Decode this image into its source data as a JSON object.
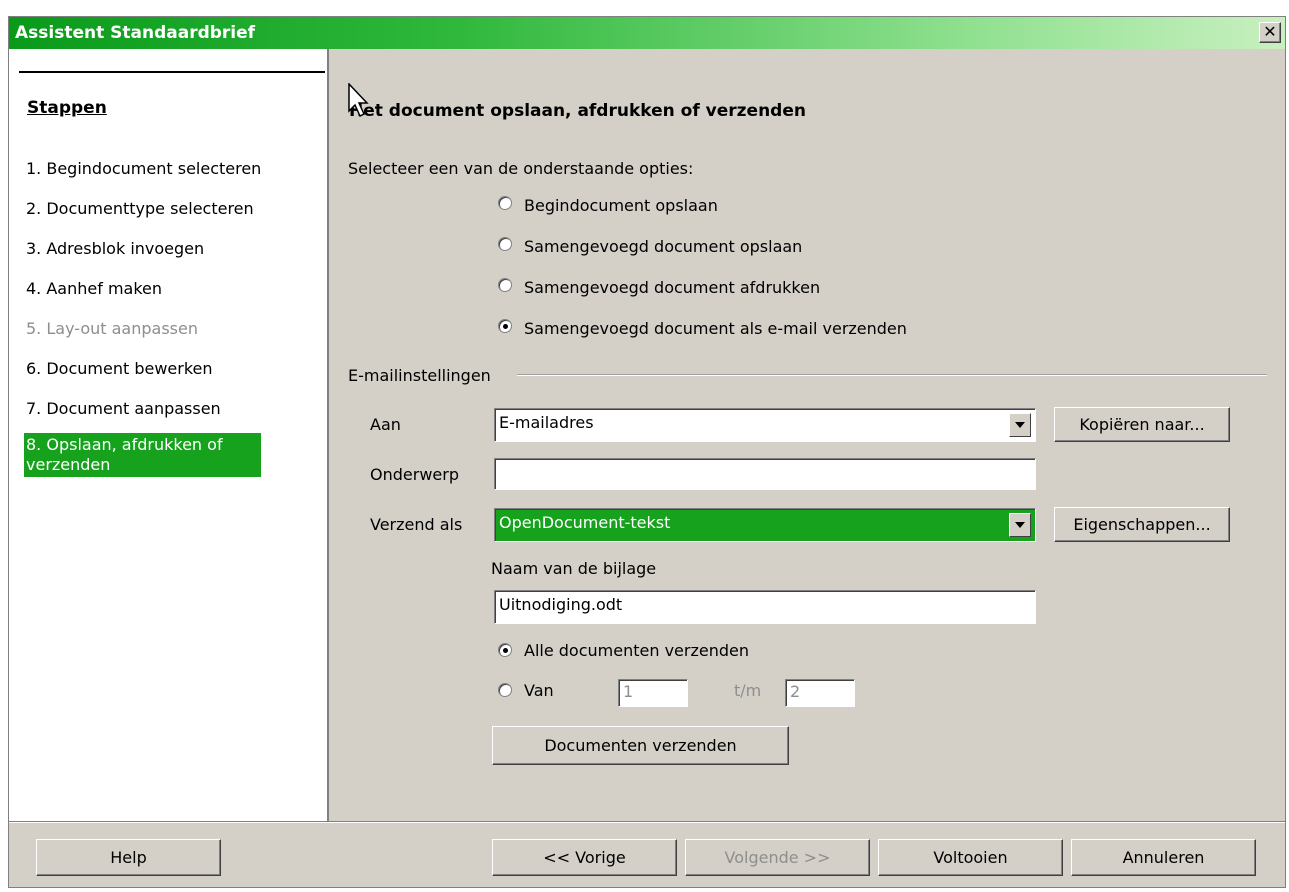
{
  "window": {
    "title": "Assistent Standaardbrief",
    "close_glyph": "✕"
  },
  "sidebar": {
    "heading": "Stappen",
    "steps": [
      {
        "label": "1. Begindocument selecteren",
        "state": "normal"
      },
      {
        "label": "2. Documenttype selecteren",
        "state": "normal"
      },
      {
        "label": "3. Adresblok invoegen",
        "state": "normal"
      },
      {
        "label": "4. Aanhef maken",
        "state": "normal"
      },
      {
        "label": "5. Lay-out aanpassen",
        "state": "disabled"
      },
      {
        "label": "6. Document bewerken",
        "state": "normal"
      },
      {
        "label": "7. Document aanpassen",
        "state": "normal"
      },
      {
        "label": "8. Opslaan, afdrukken of verzenden",
        "state": "active"
      }
    ]
  },
  "main": {
    "title": "Het document opslaan, afdrukken of verzenden",
    "prompt": "Selecteer een van de onderstaande opties:",
    "options": [
      {
        "label": "Begindocument opslaan",
        "checked": false
      },
      {
        "label": "Samengevoegd document opslaan",
        "checked": false
      },
      {
        "label": "Samengevoegd document afdrukken",
        "checked": false
      },
      {
        "label": "Samengevoegd document als e-mail verzenden",
        "checked": true
      }
    ],
    "email_group_label": "E-mailinstellingen",
    "to_label": "Aan",
    "to_value": "E-mailadres",
    "copy_to_button": "Kopiëren naar...",
    "subject_label": "Onderwerp",
    "subject_value": "",
    "send_as_label": "Verzend als",
    "send_as_value": "OpenDocument-tekst",
    "properties_button": "Eigenschappen...",
    "attachment_label": "Naam van de bijlage",
    "attachment_value": "Uitnodiging.odt",
    "send_all_label": "Alle documenten verzenden",
    "send_all_checked": true,
    "from_label": "Van",
    "from_checked": false,
    "from_value": "1",
    "to_range_label": "t/m",
    "to_range_value": "2",
    "send_docs_button": "Documenten verzenden"
  },
  "footer": {
    "help": "Help",
    "back": "<< Vorige",
    "next": "Volgende >>",
    "finish": "Voltooien",
    "cancel": "Annuleren"
  },
  "colors": {
    "accent": "#17a21e",
    "face": "#d4d0c8"
  }
}
